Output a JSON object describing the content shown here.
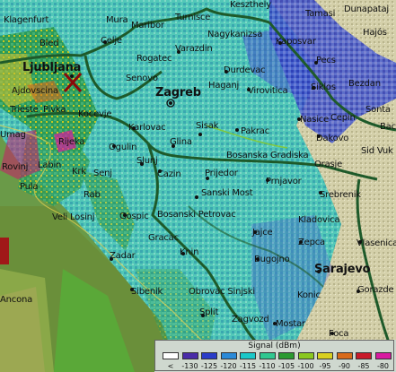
{
  "map": {
    "cities": [
      {
        "id": "klagenfurt",
        "label": "Klagenfurt",
        "cls": ""
      },
      {
        "id": "mura",
        "label": "Mura",
        "cls": ""
      },
      {
        "id": "maribor",
        "label": "Maribor",
        "cls": ""
      },
      {
        "id": "turnisce",
        "label": "Turnisce",
        "cls": ""
      },
      {
        "id": "keszthely",
        "label": "Keszthely",
        "cls": ""
      },
      {
        "id": "tamasi",
        "label": "Tamasi",
        "cls": ""
      },
      {
        "id": "dunapataj",
        "label": "Dunapataj",
        "cls": ""
      },
      {
        "id": "bled",
        "label": "Bled",
        "cls": ""
      },
      {
        "id": "celje",
        "label": "Celje",
        "cls": ""
      },
      {
        "id": "nagykanizsa",
        "label": "Nagykanizsa",
        "cls": ""
      },
      {
        "id": "kaposvar",
        "label": "Kaposvar",
        "cls": ""
      },
      {
        "id": "hajos",
        "label": "Hajós",
        "cls": ""
      },
      {
        "id": "varazdin",
        "label": "Varazdin",
        "cls": ""
      },
      {
        "id": "pecs",
        "label": "Pecs",
        "cls": ""
      },
      {
        "id": "rogatec",
        "label": "Rogatec",
        "cls": ""
      },
      {
        "id": "ljubljana",
        "label": "Ljubljana",
        "cls": "cap"
      },
      {
        "id": "durdevac",
        "label": "Durdevac",
        "cls": ""
      },
      {
        "id": "senovo",
        "label": "Senovo",
        "cls": ""
      },
      {
        "id": "virovitica",
        "label": "Virovitica",
        "cls": ""
      },
      {
        "id": "siklos",
        "label": "Siklos",
        "cls": ""
      },
      {
        "id": "bezdan",
        "label": "Bezdan",
        "cls": ""
      },
      {
        "id": "ajdovscina",
        "label": "Ajdovscina",
        "cls": ""
      },
      {
        "id": "haganj",
        "label": "Haganj",
        "cls": ""
      },
      {
        "id": "zagreb",
        "label": "Zagreb",
        "cls": "cap"
      },
      {
        "id": "sonta",
        "label": "Sonta",
        "cls": ""
      },
      {
        "id": "trieste",
        "label": "Trieste",
        "cls": ""
      },
      {
        "id": "pivka",
        "label": "Pivka",
        "cls": ""
      },
      {
        "id": "kocevje",
        "label": "Kocevje",
        "cls": ""
      },
      {
        "id": "nasice",
        "label": "Nasice",
        "cls": ""
      },
      {
        "id": "cepin",
        "label": "Cepin",
        "cls": ""
      },
      {
        "id": "karlovac",
        "label": "Karlovac",
        "cls": ""
      },
      {
        "id": "sisak",
        "label": "Sisak",
        "cls": ""
      },
      {
        "id": "pakrac",
        "label": "Pakrac",
        "cls": ""
      },
      {
        "id": "bac",
        "label": "Bac",
        "cls": ""
      },
      {
        "id": "umag",
        "label": "Umag",
        "cls": ""
      },
      {
        "id": "rijeka",
        "label": "Rijeka",
        "cls": ""
      },
      {
        "id": "glina",
        "label": "Glina",
        "cls": ""
      },
      {
        "id": "dakovo",
        "label": "Dakovo",
        "cls": ""
      },
      {
        "id": "ogulin",
        "label": "Ogulin",
        "cls": ""
      },
      {
        "id": "sidvuk",
        "label": "Sid Vuk",
        "cls": ""
      },
      {
        "id": "bosgrad",
        "label": "Bosanska Gradiska",
        "cls": ""
      },
      {
        "id": "slunj",
        "label": "Slunj",
        "cls": ""
      },
      {
        "id": "orasje",
        "label": "Orasje",
        "cls": ""
      },
      {
        "id": "rovinj",
        "label": "Rovinj",
        "cls": ""
      },
      {
        "id": "labin",
        "label": "Labin",
        "cls": ""
      },
      {
        "id": "krk",
        "label": "Krk",
        "cls": ""
      },
      {
        "id": "senj",
        "label": "Senj",
        "cls": ""
      },
      {
        "id": "cazin",
        "label": "Cazin",
        "cls": ""
      },
      {
        "id": "prijedor",
        "label": "Prijedor",
        "cls": ""
      },
      {
        "id": "prnjavor",
        "label": "Prnjavor",
        "cls": ""
      },
      {
        "id": "pula",
        "label": "Pula",
        "cls": ""
      },
      {
        "id": "rab",
        "label": "Rab",
        "cls": ""
      },
      {
        "id": "sanskimost",
        "label": "Sanski Most",
        "cls": ""
      },
      {
        "id": "srebrenik",
        "label": "Srebrenik",
        "cls": ""
      },
      {
        "id": "velilosinj",
        "label": "Veli Losinj",
        "cls": ""
      },
      {
        "id": "gospic",
        "label": "Gospic",
        "cls": ""
      },
      {
        "id": "bospetrovac",
        "label": "Bosanski Petrovac",
        "cls": ""
      },
      {
        "id": "kladovica",
        "label": "Kladovica",
        "cls": ""
      },
      {
        "id": "jajce",
        "label": "Jajce",
        "cls": ""
      },
      {
        "id": "gracac",
        "label": "Gracac",
        "cls": ""
      },
      {
        "id": "zepca",
        "label": "Zepca",
        "cls": ""
      },
      {
        "id": "vlasenica",
        "label": "Vlasenica",
        "cls": ""
      },
      {
        "id": "zadar",
        "label": "Zadar",
        "cls": ""
      },
      {
        "id": "knin",
        "label": "Knin",
        "cls": ""
      },
      {
        "id": "bugojno",
        "label": "Bugojno",
        "cls": ""
      },
      {
        "id": "sarajevo",
        "label": "Sarajevo",
        "cls": "cap"
      },
      {
        "id": "ancona",
        "label": "Ancona",
        "cls": ""
      },
      {
        "id": "sibenik",
        "label": "Sibenik",
        "cls": ""
      },
      {
        "id": "obrovac",
        "label": "Obrovac Sinjski",
        "cls": ""
      },
      {
        "id": "konic",
        "label": "Konic",
        "cls": ""
      },
      {
        "id": "gorazde",
        "label": "Gorazde",
        "cls": ""
      },
      {
        "id": "split",
        "label": "Split",
        "cls": ""
      },
      {
        "id": "zagvozd",
        "label": "Zagvozd",
        "cls": ""
      },
      {
        "id": "mostar",
        "label": "Mostar",
        "cls": ""
      },
      {
        "id": "foca",
        "label": "Foca",
        "cls": ""
      }
    ],
    "marker_label": "Ljubljana transmitter"
  },
  "legend": {
    "title": "Signal (dBm)",
    "items": [
      {
        "label": "<",
        "color": "#ffffff"
      },
      {
        "label": "-130",
        "color": "#4a2ca8"
      },
      {
        "label": "-125",
        "color": "#2a3cc8"
      },
      {
        "label": "-120",
        "color": "#2a8ad8"
      },
      {
        "label": "-115",
        "color": "#1ac8c8"
      },
      {
        "label": "-110",
        "color": "#30c890"
      },
      {
        "label": "-105",
        "color": "#2a9a30"
      },
      {
        "label": "-100",
        "color": "#8ac820"
      },
      {
        "label": "-95",
        "color": "#d8d020"
      },
      {
        "label": "-90",
        "color": "#d86a1a"
      },
      {
        "label": "-85",
        "color": "#c81a2a"
      },
      {
        "label": "-80",
        "color": "#d81aa0"
      }
    ]
  },
  "colors": {
    "sea": "#6a9a48",
    "seaGreen": "#58a830",
    "cyanLand": "#4cc0b0",
    "tealLand": "#38a8a0",
    "blueNoise": "#3848c8",
    "beige": "#cfcca6",
    "border": "#1e5a2a"
  }
}
